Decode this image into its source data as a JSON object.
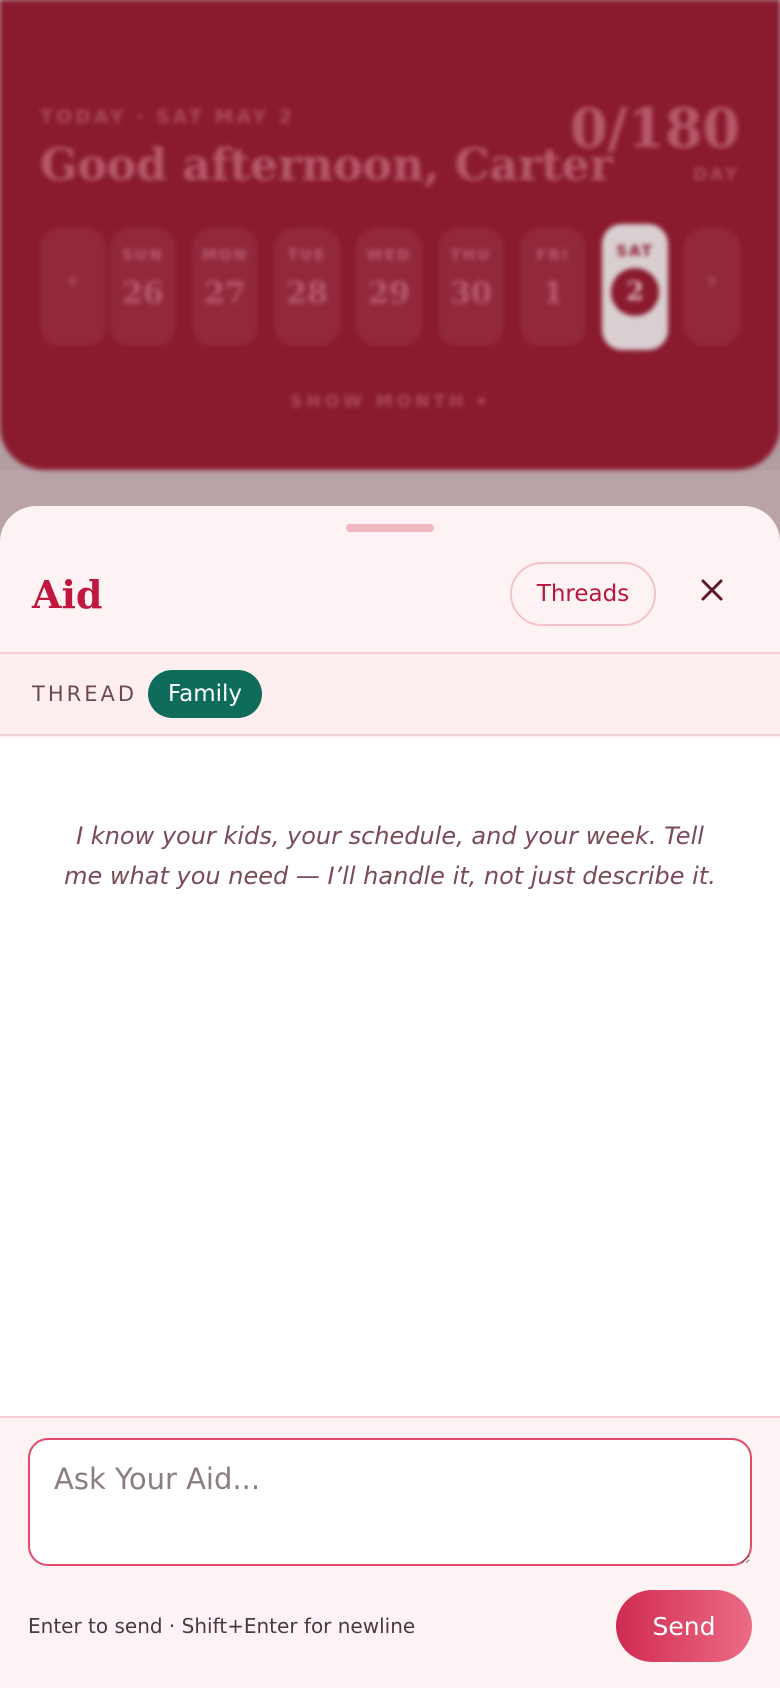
{
  "background": {
    "date_label": "TODAY · SAT MAY 2",
    "greeting": "Good afternoon, Carter",
    "counter": "0/180",
    "counter_unit": "DAY",
    "days": [
      {
        "name": "SUN",
        "date": "26"
      },
      {
        "name": "MON",
        "date": "27"
      },
      {
        "name": "TUE",
        "date": "28"
      },
      {
        "name": "WED",
        "date": "29"
      },
      {
        "name": "THU",
        "date": "30"
      },
      {
        "name": "FRI",
        "date": "1"
      },
      {
        "name": "SAT",
        "date": "2"
      }
    ],
    "prev_glyph": "‹",
    "next_glyph": "›",
    "show_month": "SHOW MONTH ▾"
  },
  "sheet": {
    "title": "Aid",
    "threads_label": "Threads",
    "close_icon": "close-icon"
  },
  "thread": {
    "label": "THREAD",
    "active": "Family"
  },
  "messages": {
    "intro": "I know your kids, your schedule, and your week. Tell me what you need — I’ll handle it, not just describe it."
  },
  "composer": {
    "placeholder": "Ask Your Aid...",
    "value": "",
    "hint": "Enter to send · Shift+Enter for newline",
    "send_label": "Send"
  },
  "colors": {
    "brand": "#8a1a2e",
    "accent": "#c0173f",
    "chip": "#0f6b5a",
    "sheet_bg": "#fdf3f4"
  }
}
